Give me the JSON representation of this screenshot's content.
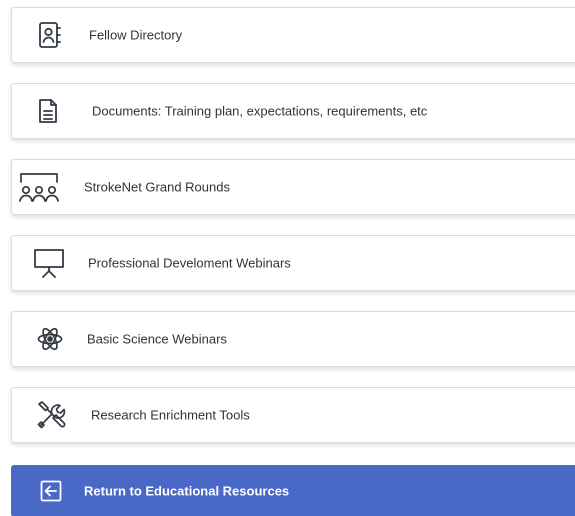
{
  "menu": {
    "items": [
      {
        "label": "Fellow Directory",
        "icon": "contact-book-icon"
      },
      {
        "label": "Documents: Training plan, expectations, requirements, etc",
        "icon": "document-icon"
      },
      {
        "label": "StrokeNet Grand Rounds",
        "icon": "audience-icon"
      },
      {
        "label": "Professional Develoment Webinars",
        "icon": "presentation-easel-icon"
      },
      {
        "label": "Basic Science Webinars",
        "icon": "atom-icon"
      },
      {
        "label": "Research Enrichment Tools",
        "icon": "tools-icon"
      }
    ],
    "return_button": {
      "label": "Return to Educational Resources",
      "icon": "arrow-left-box-icon"
    }
  },
  "colors": {
    "primary": "#4a68c6",
    "text": "#333333",
    "border": "#dcdcdc"
  }
}
